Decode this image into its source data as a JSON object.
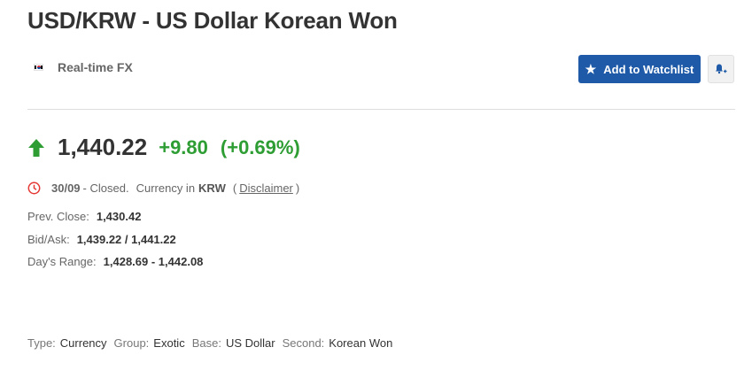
{
  "header": {
    "title": "USD/KRW - US Dollar Korean Won",
    "source_label": "Real-time FX",
    "watchlist_label": "Add to Watchlist"
  },
  "quote": {
    "last": "1,440.22",
    "change": "+9.80",
    "change_pct": "(+0.69%)",
    "direction": "up",
    "change_color": "#2e9d34"
  },
  "status": {
    "date": "30/09",
    "closed_text": "- Closed.",
    "currency_label": "Currency in",
    "currency": "KRW",
    "open_paren": "(",
    "disclaimer": "Disclaimer",
    "close_paren": ")"
  },
  "stats": {
    "prev_close_label": "Prev. Close:",
    "prev_close": "1,430.42",
    "bid_ask_label": "Bid/Ask:",
    "bid_ask": "1,439.22 / 1,441.22",
    "days_range_label": "Day's Range:",
    "days_range": "1,428.69 - 1,442.08"
  },
  "meta": {
    "type_label": "Type:",
    "type": "Currency",
    "group_label": "Group:",
    "group": "Exotic",
    "base_label": "Base:",
    "base": "US Dollar",
    "second_label": "Second:",
    "second": "Korean Won"
  },
  "icons": {
    "flag": "south-korea-flag-icon",
    "star": "star-icon",
    "bell": "bell-plus-icon",
    "arrow": "arrow-up-icon",
    "clock": "clock-icon"
  },
  "colors": {
    "accent": "#1e5aa8",
    "positive": "#2e9d34",
    "closed_clock": "#e53935"
  }
}
